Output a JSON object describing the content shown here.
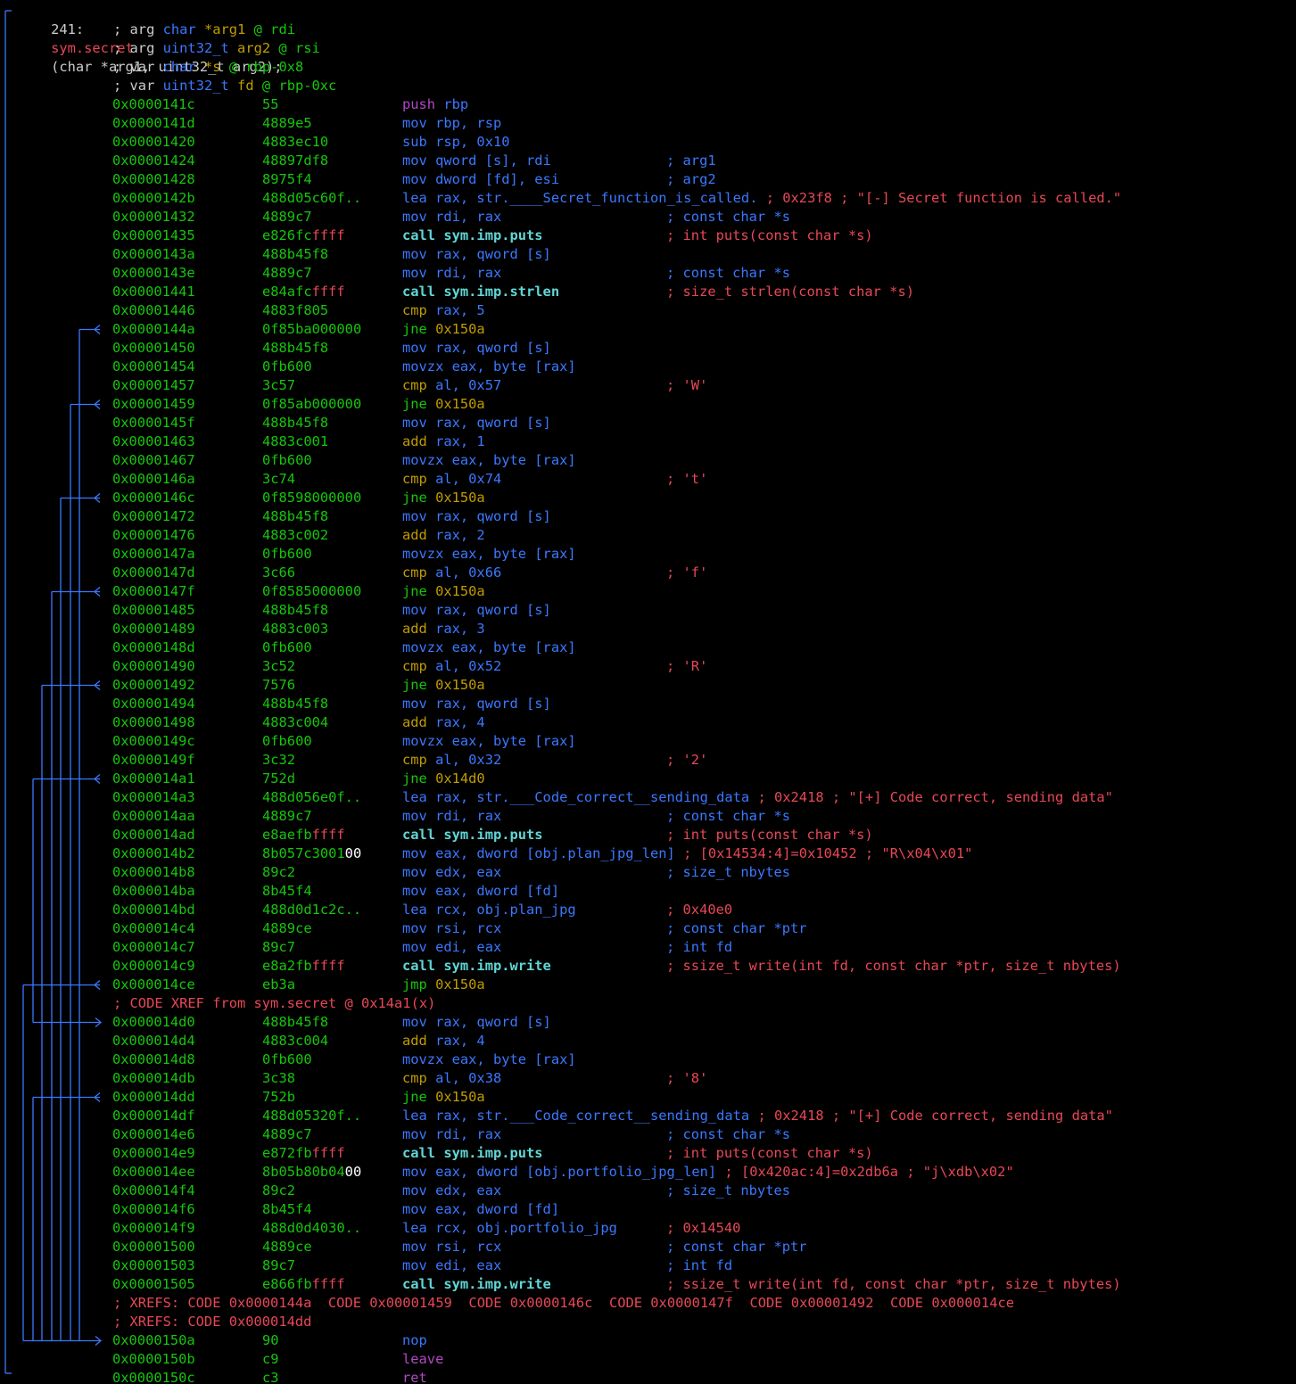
{
  "function": {
    "index": "241:",
    "name": "sym.secret",
    "signature": "(char *arg1, uint32_t arg2);"
  },
  "vars": [
    {
      "kw": "; arg",
      "type": "char",
      "name": "*arg1",
      "at": "@",
      "loc": "rdi"
    },
    {
      "kw": "; arg",
      "type": "uint32_t",
      "name": "arg2",
      "at": "@",
      "loc": "rsi"
    },
    {
      "kw": "; var",
      "type": "char",
      "name": "*s",
      "at": "@",
      "loc": "rbp-0x8"
    },
    {
      "kw": "; var",
      "type": "uint32_t",
      "name": "fd",
      "at": "@",
      "loc": "rbp-0xc"
    }
  ],
  "rows": [
    {
      "addr": "0x0000141c",
      "bytes": "55",
      "mn": "push",
      "mc": "m-push",
      "op": "rbp",
      "cm": ""
    },
    {
      "addr": "0x0000141d",
      "bytes": "4889e5",
      "mn": "mov",
      "mc": "m-mov",
      "op": "rbp, rsp",
      "cm": ""
    },
    {
      "addr": "0x00001420",
      "bytes": "4883ec10",
      "mn": "sub",
      "mc": "m-mov",
      "op": "rsp, 0x10",
      "cm": ""
    },
    {
      "addr": "0x00001424",
      "bytes": "48897df8",
      "mn": "mov",
      "mc": "m-mov",
      "op": "qword [s], rdi",
      "cm": "; arg1",
      "cc": "c-blue"
    },
    {
      "addr": "0x00001428",
      "bytes": "8975f4",
      "mn": "mov",
      "mc": "m-mov",
      "op": "dword [fd], esi",
      "cm": "; arg2",
      "cc": "c-blue"
    },
    {
      "addr": "0x0000142b",
      "bytes": "488d05c60f..",
      "mn": "lea",
      "mc": "m-mov",
      "op": "rax, str.____Secret_function_is_called.",
      "tail": " ; 0x23f8 ; \"[-] Secret function is called.\"",
      "tc": "c-red"
    },
    {
      "addr": "0x00001432",
      "bytes": "4889c7",
      "mn": "mov",
      "mc": "m-mov",
      "op": "rdi, rax",
      "cm": "; const char *s",
      "cc": "c-blue"
    },
    {
      "addr": "0x00001435",
      "bytes": "e826fc",
      "bhi": "ffff",
      "mn": "call",
      "mc": "m-call",
      "op": "sym.imp.puts",
      "oc": "opnd-sym",
      "cm": "; int puts(const char *s)",
      "cc": "c-red"
    },
    {
      "addr": "0x0000143a",
      "bytes": "488b45f8",
      "mn": "mov",
      "mc": "m-mov",
      "op": "rax, qword [s]",
      "cm": ""
    },
    {
      "addr": "0x0000143e",
      "bytes": "4889c7",
      "mn": "mov",
      "mc": "m-mov",
      "op": "rdi, rax",
      "cm": "; const char *s",
      "cc": "c-blue"
    },
    {
      "addr": "0x00001441",
      "bytes": "e84afc",
      "bhi": "ffff",
      "mn": "call",
      "mc": "m-call",
      "op": "sym.imp.strlen",
      "oc": "opnd-sym",
      "cm": "; size_t strlen(const char *s)",
      "cc": "c-red"
    },
    {
      "addr": "0x00001446",
      "bytes": "4883f805",
      "mn": "cmp",
      "mc": "m-cmp",
      "op": "rax, 5",
      "cm": ""
    },
    {
      "addr": "0x0000144a",
      "bytes": "0f85ba",
      "bmid": "000000",
      "mn": "jne",
      "mc": "m-jne",
      "op": "0x150a",
      "oc": "opnd-num",
      "cm": ""
    },
    {
      "addr": "0x00001450",
      "bytes": "488b45f8",
      "mn": "mov",
      "mc": "m-mov",
      "op": "rax, qword [s]",
      "cm": ""
    },
    {
      "addr": "0x00001454",
      "bytes": "0fb600",
      "mn": "movzx",
      "mc": "m-mov",
      "op": "eax, byte [rax]",
      "cm": ""
    },
    {
      "addr": "0x00001457",
      "bytes": "3c57",
      "mn": "cmp",
      "mc": "m-cmp",
      "op": "al, 0x57",
      "cm": "; 'W'",
      "cc": "c-red"
    },
    {
      "addr": "0x00001459",
      "bytes": "0f85ab",
      "bmid": "000000",
      "mn": "jne",
      "mc": "m-jne",
      "op": "0x150a",
      "oc": "opnd-num",
      "cm": ""
    },
    {
      "addr": "0x0000145f",
      "bytes": "488b45f8",
      "mn": "mov",
      "mc": "m-mov",
      "op": "rax, qword [s]",
      "cm": ""
    },
    {
      "addr": "0x00001463",
      "bytes": "4883c001",
      "mn": "add",
      "mc": "m-cmp",
      "op": "rax, 1",
      "cm": ""
    },
    {
      "addr": "0x00001467",
      "bytes": "0fb600",
      "mn": "movzx",
      "mc": "m-mov",
      "op": "eax, byte [rax]",
      "cm": ""
    },
    {
      "addr": "0x0000146a",
      "bytes": "3c74",
      "mn": "cmp",
      "mc": "m-cmp",
      "op": "al, 0x74",
      "cm": "; 't'",
      "cc": "c-red"
    },
    {
      "addr": "0x0000146c",
      "bytes": "0f8598",
      "bmid": "000000",
      "mn": "jne",
      "mc": "m-jne",
      "op": "0x150a",
      "oc": "opnd-num",
      "cm": ""
    },
    {
      "addr": "0x00001472",
      "bytes": "488b45f8",
      "mn": "mov",
      "mc": "m-mov",
      "op": "rax, qword [s]",
      "cm": ""
    },
    {
      "addr": "0x00001476",
      "bytes": "4883c002",
      "mn": "add",
      "mc": "m-cmp",
      "op": "rax, 2",
      "cm": ""
    },
    {
      "addr": "0x0000147a",
      "bytes": "0fb600",
      "mn": "movzx",
      "mc": "m-mov",
      "op": "eax, byte [rax]",
      "cm": ""
    },
    {
      "addr": "0x0000147d",
      "bytes": "3c66",
      "mn": "cmp",
      "mc": "m-cmp",
      "op": "al, 0x66",
      "cm": "; 'f'",
      "cc": "c-red"
    },
    {
      "addr": "0x0000147f",
      "bytes": "0f8585",
      "bmid": "000000",
      "mn": "jne",
      "mc": "m-jne",
      "op": "0x150a",
      "oc": "opnd-num",
      "cm": ""
    },
    {
      "addr": "0x00001485",
      "bytes": "488b45f8",
      "mn": "mov",
      "mc": "m-mov",
      "op": "rax, qword [s]",
      "cm": ""
    },
    {
      "addr": "0x00001489",
      "bytes": "4883c003",
      "mn": "add",
      "mc": "m-cmp",
      "op": "rax, 3",
      "cm": ""
    },
    {
      "addr": "0x0000148d",
      "bytes": "0fb600",
      "mn": "movzx",
      "mc": "m-mov",
      "op": "eax, byte [rax]",
      "cm": ""
    },
    {
      "addr": "0x00001490",
      "bytes": "3c52",
      "mn": "cmp",
      "mc": "m-cmp",
      "op": "al, 0x52",
      "cm": "; 'R'",
      "cc": "c-red"
    },
    {
      "addr": "0x00001492",
      "bytes": "7576",
      "mn": "jne",
      "mc": "m-jne",
      "op": "0x150a",
      "oc": "opnd-num",
      "cm": ""
    },
    {
      "addr": "0x00001494",
      "bytes": "488b45f8",
      "mn": "mov",
      "mc": "m-mov",
      "op": "rax, qword [s]",
      "cm": ""
    },
    {
      "addr": "0x00001498",
      "bytes": "4883c004",
      "mn": "add",
      "mc": "m-cmp",
      "op": "rax, 4",
      "cm": ""
    },
    {
      "addr": "0x0000149c",
      "bytes": "0fb600",
      "mn": "movzx",
      "mc": "m-mov",
      "op": "eax, byte [rax]",
      "cm": ""
    },
    {
      "addr": "0x0000149f",
      "bytes": "3c32",
      "mn": "cmp",
      "mc": "m-cmp",
      "op": "al, 0x32",
      "cm": "; '2'",
      "cc": "c-red"
    },
    {
      "addr": "0x000014a1",
      "bytes": "752d",
      "mn": "jne",
      "mc": "m-jne",
      "op": "0x14d0",
      "oc": "opnd-num",
      "cm": ""
    },
    {
      "addr": "0x000014a3",
      "bytes": "488d056e0f..",
      "mn": "lea",
      "mc": "m-mov",
      "op": "rax, str.___Code_correct__sending_data",
      "tail": " ; 0x2418 ; \"[+] Code correct, sending data\"",
      "tc": "c-red"
    },
    {
      "addr": "0x000014aa",
      "bytes": "4889c7",
      "mn": "mov",
      "mc": "m-mov",
      "op": "rdi, rax",
      "cm": "; const char *s",
      "cc": "c-blue"
    },
    {
      "addr": "0x000014ad",
      "bytes": "e8aefb",
      "bhi": "ffff",
      "mn": "call",
      "mc": "m-call",
      "op": "sym.imp.puts",
      "oc": "opnd-sym",
      "cm": "; int puts(const char *s)",
      "cc": "c-red"
    },
    {
      "addr": "0x000014b2",
      "bytes": "8b057c3001",
      "blo": "00",
      "mn": "mov",
      "mc": "m-mov",
      "op": "eax, dword [obj.plan_jpg_len]",
      "tail": " ; [0x14534:4]=0x10452 ; \"R\\x04\\x01\"",
      "tc": "c-red"
    },
    {
      "addr": "0x000014b8",
      "bytes": "89c2",
      "mn": "mov",
      "mc": "m-mov",
      "op": "edx, eax",
      "cm": "; size_t nbytes",
      "cc": "c-blue"
    },
    {
      "addr": "0x000014ba",
      "bytes": "8b45f4",
      "mn": "mov",
      "mc": "m-mov",
      "op": "eax, dword [fd]",
      "cm": ""
    },
    {
      "addr": "0x000014bd",
      "bytes": "488d0d1c2c..",
      "mn": "lea",
      "mc": "m-mov",
      "op": "rcx, obj.plan_jpg",
      "cm": "; 0x40e0",
      "cc": "c-red"
    },
    {
      "addr": "0x000014c4",
      "bytes": "4889ce",
      "mn": "mov",
      "mc": "m-mov",
      "op": "rsi, rcx",
      "cm": "; const char *ptr",
      "cc": "c-blue"
    },
    {
      "addr": "0x000014c7",
      "bytes": "89c7",
      "mn": "mov",
      "mc": "m-mov",
      "op": "edi, eax",
      "cm": "; int fd",
      "cc": "c-blue"
    },
    {
      "addr": "0x000014c9",
      "bytes": "e8a2fb",
      "bhi": "ffff",
      "mn": "call",
      "mc": "m-call",
      "op": "sym.imp.write",
      "oc": "opnd-sym",
      "cm": "; ssize_t write(int fd, const char *ptr, size_t nbytes)",
      "cc": "c-red"
    },
    {
      "addr": "0x000014ce",
      "bytes": "eb3a",
      "mn": "jmp",
      "mc": "m-jne",
      "op": "0x150a",
      "oc": "opnd-num",
      "cm": ""
    },
    {
      "kind": "comment",
      "text": "; CODE XREF from sym.secret @ 0x14a1(x)"
    },
    {
      "addr": "0x000014d0",
      "bytes": "488b45f8",
      "mn": "mov",
      "mc": "m-mov",
      "op": "rax, qword [s]",
      "cm": ""
    },
    {
      "addr": "0x000014d4",
      "bytes": "4883c004",
      "mn": "add",
      "mc": "m-cmp",
      "op": "rax, 4",
      "cm": ""
    },
    {
      "addr": "0x000014d8",
      "bytes": "0fb600",
      "mn": "movzx",
      "mc": "m-mov",
      "op": "eax, byte [rax]",
      "cm": ""
    },
    {
      "addr": "0x000014db",
      "bytes": "3c38",
      "mn": "cmp",
      "mc": "m-cmp",
      "op": "al, 0x38",
      "cm": "; '8'",
      "cc": "c-red"
    },
    {
      "addr": "0x000014dd",
      "bytes": "752b",
      "mn": "jne",
      "mc": "m-jne",
      "op": "0x150a",
      "oc": "opnd-num",
      "cm": ""
    },
    {
      "addr": "0x000014df",
      "bytes": "488d05320f..",
      "mn": "lea",
      "mc": "m-mov",
      "op": "rax, str.___Code_correct__sending_data",
      "tail": " ; 0x2418 ; \"[+] Code correct, sending data\"",
      "tc": "c-red"
    },
    {
      "addr": "0x000014e6",
      "bytes": "4889c7",
      "mn": "mov",
      "mc": "m-mov",
      "op": "rdi, rax",
      "cm": "; const char *s",
      "cc": "c-blue"
    },
    {
      "addr": "0x000014e9",
      "bytes": "e872fb",
      "bhi": "ffff",
      "mn": "call",
      "mc": "m-call",
      "op": "sym.imp.puts",
      "oc": "opnd-sym",
      "cm": "; int puts(const char *s)",
      "cc": "c-red"
    },
    {
      "addr": "0x000014ee",
      "bytes": "8b05b80b04",
      "blo": "00",
      "mn": "mov",
      "mc": "m-mov",
      "op": "eax, dword [obj.portfolio_jpg_len]",
      "tail": " ; [0x420ac:4]=0x2db6a ; \"j\\xdb\\x02\"",
      "tc": "c-red"
    },
    {
      "addr": "0x000014f4",
      "bytes": "89c2",
      "mn": "mov",
      "mc": "m-mov",
      "op": "edx, eax",
      "cm": "; size_t nbytes",
      "cc": "c-blue"
    },
    {
      "addr": "0x000014f6",
      "bytes": "8b45f4",
      "mn": "mov",
      "mc": "m-mov",
      "op": "eax, dword [fd]",
      "cm": ""
    },
    {
      "addr": "0x000014f9",
      "bytes": "488d0d4030..",
      "mn": "lea",
      "mc": "m-mov",
      "op": "rcx, obj.portfolio_jpg",
      "cm": "; 0x14540",
      "cc": "c-red"
    },
    {
      "addr": "0x00001500",
      "bytes": "4889ce",
      "mn": "mov",
      "mc": "m-mov",
      "op": "rsi, rcx",
      "cm": "; const char *ptr",
      "cc": "c-blue"
    },
    {
      "addr": "0x00001503",
      "bytes": "89c7",
      "mn": "mov",
      "mc": "m-mov",
      "op": "edi, eax",
      "cm": "; int fd",
      "cc": "c-blue"
    },
    {
      "addr": "0x00001505",
      "bytes": "e866fb",
      "bhi": "ffff",
      "mn": "call",
      "mc": "m-call",
      "op": "sym.imp.write",
      "oc": "opnd-sym",
      "cm": "; ssize_t write(int fd, const char *ptr, size_t nbytes)",
      "cc": "c-red"
    },
    {
      "kind": "comment",
      "text": "; XREFS: CODE 0x0000144a  CODE 0x00001459  CODE 0x0000146c  CODE 0x0000147f  CODE 0x00001492  CODE 0x000014ce"
    },
    {
      "kind": "comment",
      "text": "; XREFS: CODE 0x000014dd"
    },
    {
      "addr": "0x0000150a",
      "bytes": "90",
      "mn": "nop",
      "mc": "m-nop",
      "op": "",
      "cm": ""
    },
    {
      "addr": "0x0000150b",
      "bytes": "c9",
      "mn": "leave",
      "mc": "m-push",
      "op": "",
      "cm": ""
    },
    {
      "addr": "0x0000150c",
      "bytes": "c3",
      "mn": "ret",
      "mc": "m-ret",
      "op": "",
      "cm": ""
    }
  ],
  "colors": {
    "background": "#000000",
    "address": "#16c60c",
    "flow_lines": "#3b78ff",
    "comment_red": "#e74856",
    "register_blue": "#3b78ff",
    "number_yellow": "#c19c00"
  }
}
